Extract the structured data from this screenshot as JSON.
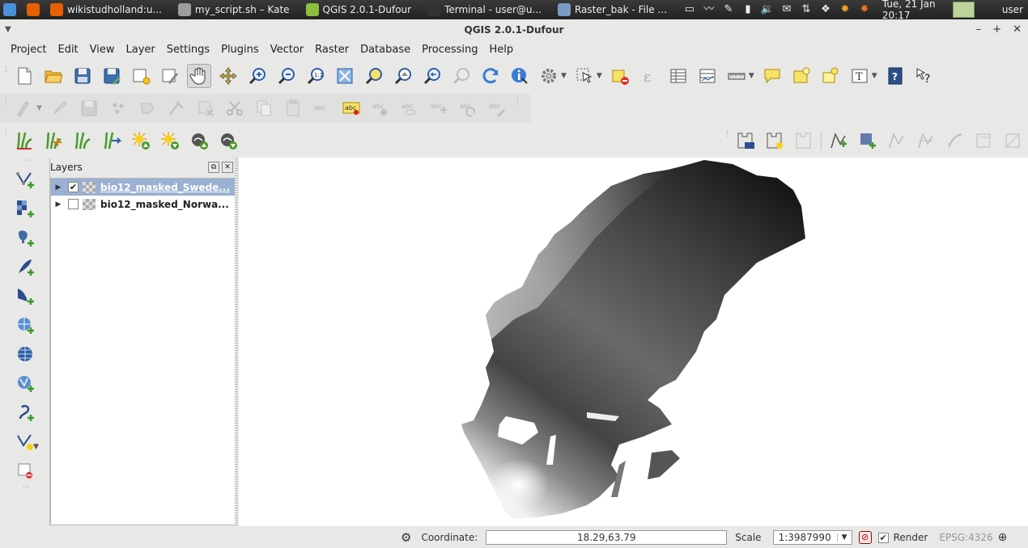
{
  "os_panel": {
    "tasks": [
      {
        "label": "",
        "icon": "distro-logo-icon",
        "color": "#4a90d9"
      },
      {
        "label": "",
        "icon": "firefox-icon",
        "color": "#e66000"
      },
      {
        "label": "wikistudholland:u...",
        "icon": "firefox-icon",
        "color": "#e66000"
      },
      {
        "label": "my_script.sh – Kate",
        "icon": "kate-icon",
        "color": "#9d9d9d"
      },
      {
        "label": "QGIS 2.0.1-Dufour",
        "icon": "qgis-icon",
        "color": "#8bbf3d"
      },
      {
        "label": "Terminal - user@u...",
        "icon": "terminal-icon",
        "color": "#333333"
      },
      {
        "label": "Raster_bak - File ...",
        "icon": "folder-icon",
        "color": "#7a9bc4"
      }
    ],
    "clock": "Tue, 21 Jan  20:17",
    "user": "user"
  },
  "window": {
    "title": "QGIS 2.0.1-Dufour",
    "buttons": [
      "–",
      "+",
      "✕"
    ]
  },
  "menu": [
    "Project",
    "Edit",
    "View",
    "Layer",
    "Settings",
    "Plugins",
    "Vector",
    "Raster",
    "Database",
    "Processing",
    "Help"
  ],
  "layers_panel": {
    "title": "Layers",
    "layers": [
      {
        "name": "bio12_masked_Swede...",
        "checked": true,
        "selected": true
      },
      {
        "name": "bio12_masked_Norwa...",
        "checked": false,
        "selected": false
      }
    ]
  },
  "status": {
    "coordinate_label": "Coordinate:",
    "coordinate_value": "18.29,63.79",
    "scale_label": "Scale",
    "scale_value": "1:3987990",
    "render_label": "Render",
    "render_checked": true,
    "crs": "EPSG:4326"
  },
  "colors": {
    "selection": "#9bb1d3",
    "panel_bg": "#e8e8e7"
  }
}
